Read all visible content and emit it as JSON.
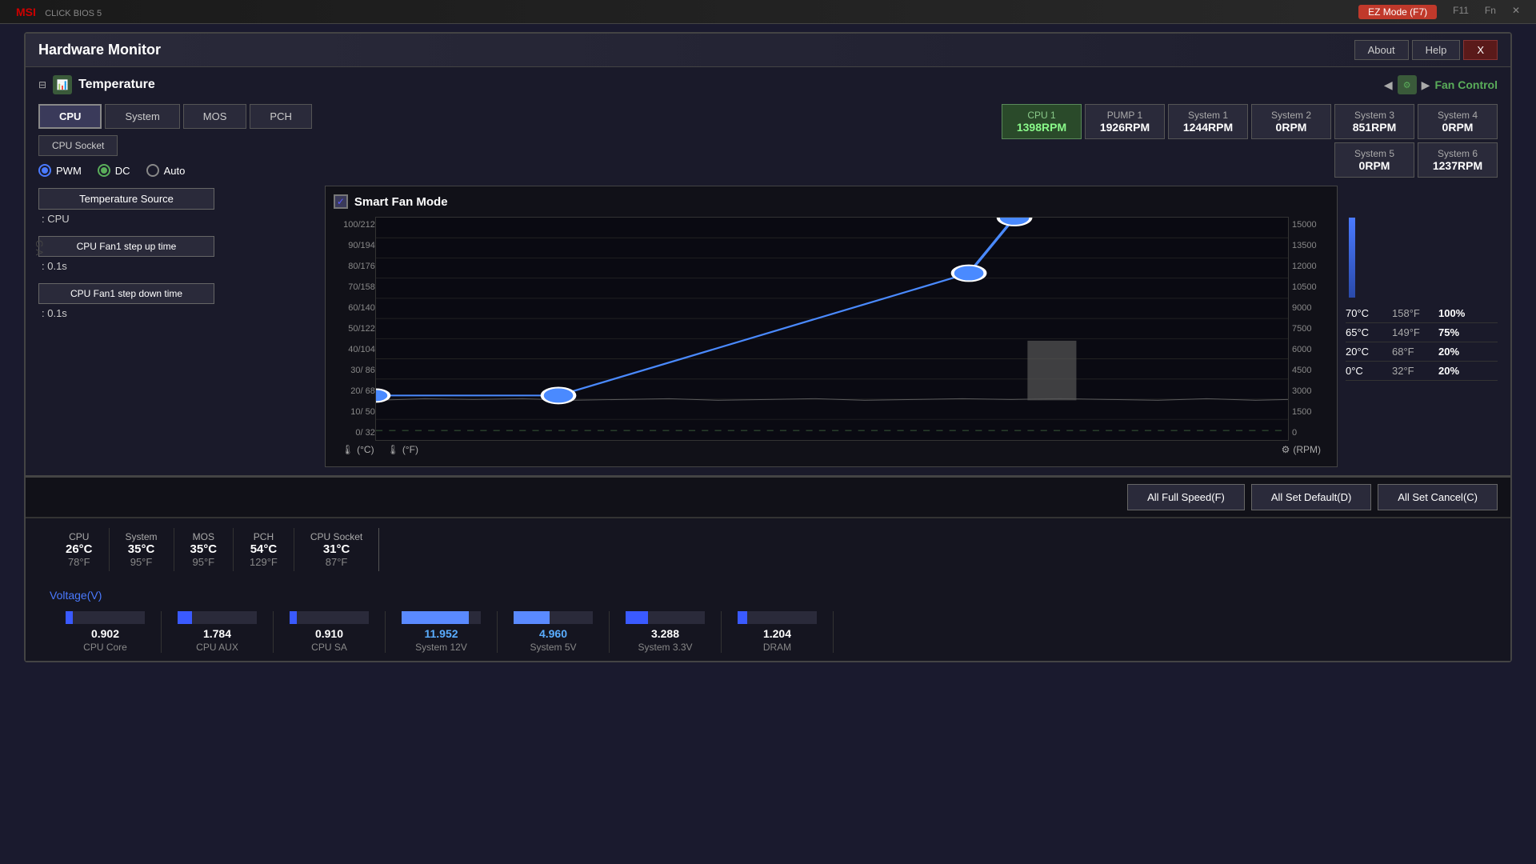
{
  "topBar": {
    "brand": "MSI",
    "ezMode": "EZ Mode (F7)",
    "f11": "F11",
    "fn": "Fn",
    "close": "X"
  },
  "window": {
    "title": "Hardware Monitor",
    "aboutBtn": "About",
    "helpBtn": "Help",
    "closeBtn": "X"
  },
  "temperature": {
    "sectionTitle": "Temperature",
    "fanControlLabel": "Fan Control",
    "tabs": [
      "CPU",
      "System",
      "MOS",
      "PCH"
    ],
    "activeTab": "CPU",
    "cpuSocketBtn": "CPU Socket",
    "fans": {
      "row1": [
        {
          "label": "CPU 1",
          "value": "1398RPM",
          "active": true
        },
        {
          "label": "PUMP 1",
          "value": "1926RPM",
          "active": false
        },
        {
          "label": "System 1",
          "value": "1244RPM",
          "active": false
        },
        {
          "label": "System 2",
          "value": "0RPM",
          "active": false
        },
        {
          "label": "System 3",
          "value": "851RPM",
          "active": false
        },
        {
          "label": "System 4",
          "value": "0RPM",
          "active": false
        }
      ],
      "row2": [
        {
          "label": "System 5",
          "value": "0RPM",
          "active": false
        },
        {
          "label": "System 6",
          "value": "1237RPM",
          "active": false
        }
      ]
    }
  },
  "fanControl": {
    "smartFanLabel": "Smart Fan Mode",
    "modeOptions": [
      "PWM",
      "DC",
      "Auto"
    ],
    "selectedMode": "PWM",
    "temperatureSourceLabel": "Temperature Source",
    "temperatureSourceValue": ": CPU",
    "stepUpLabel": "CPU Fan1 step up time",
    "stepUpValue": ": 0.1s",
    "stepDownLabel": "CPU Fan1 step down time",
    "stepDownValue": ": 0.1s",
    "tempSpeedPoints": [
      {
        "tempC": "70°C",
        "tempF": "158°F",
        "speed": "100%"
      },
      {
        "tempC": "65°C",
        "tempF": "149°F",
        "speed": "75%"
      },
      {
        "tempC": "20°C",
        "tempF": "68°F",
        "speed": "20%"
      },
      {
        "tempC": "0°C",
        "tempF": "32°F",
        "speed": "20%"
      }
    ],
    "yLabels": [
      "100/212",
      "90/194",
      "80/176",
      "70/158",
      "60/140",
      "50/122",
      "40/104",
      "30/ 86",
      "20/ 68",
      "10/ 50",
      "0/ 32"
    ],
    "yRight": [
      "15000",
      "13500",
      "12000",
      "10500",
      "9000",
      "7500",
      "6000",
      "4500",
      "3000",
      "1500",
      "0"
    ],
    "unitC": "(°C)",
    "unitF": "(°F)",
    "unitRPM": "(RPM)",
    "actionButtons": [
      "All Full Speed(F)",
      "All Set Default(D)",
      "All Set Cancel(C)"
    ]
  },
  "bottomReadings": {
    "items": [
      {
        "label": "CPU",
        "valueC": "26°C",
        "valueF": "78°F"
      },
      {
        "label": "System",
        "valueC": "35°C",
        "valueF": "95°F"
      },
      {
        "label": "MOS",
        "valueC": "35°C",
        "valueF": "95°F"
      },
      {
        "label": "PCH",
        "valueC": "54°C",
        "valueF": "129°F"
      },
      {
        "label": "CPU Socket",
        "valueC": "31°C",
        "valueF": "87°F"
      }
    ]
  },
  "voltage": {
    "title": "Voltage(V)",
    "items": [
      {
        "label": "CPU Core",
        "value": "0.902",
        "pct": 9
      },
      {
        "label": "CPU AUX",
        "value": "1.784",
        "pct": 18
      },
      {
        "label": "CPU SA",
        "value": "0.910",
        "pct": 9
      },
      {
        "label": "System 12V",
        "value": "11.952",
        "pct": 85,
        "bright": true
      },
      {
        "label": "System 5V",
        "value": "4.960",
        "pct": 40,
        "bright": true
      },
      {
        "label": "System 3.3V",
        "value": "3.288",
        "pct": 28
      },
      {
        "label": "DRAM",
        "value": "1.204",
        "pct": 12
      }
    ]
  }
}
